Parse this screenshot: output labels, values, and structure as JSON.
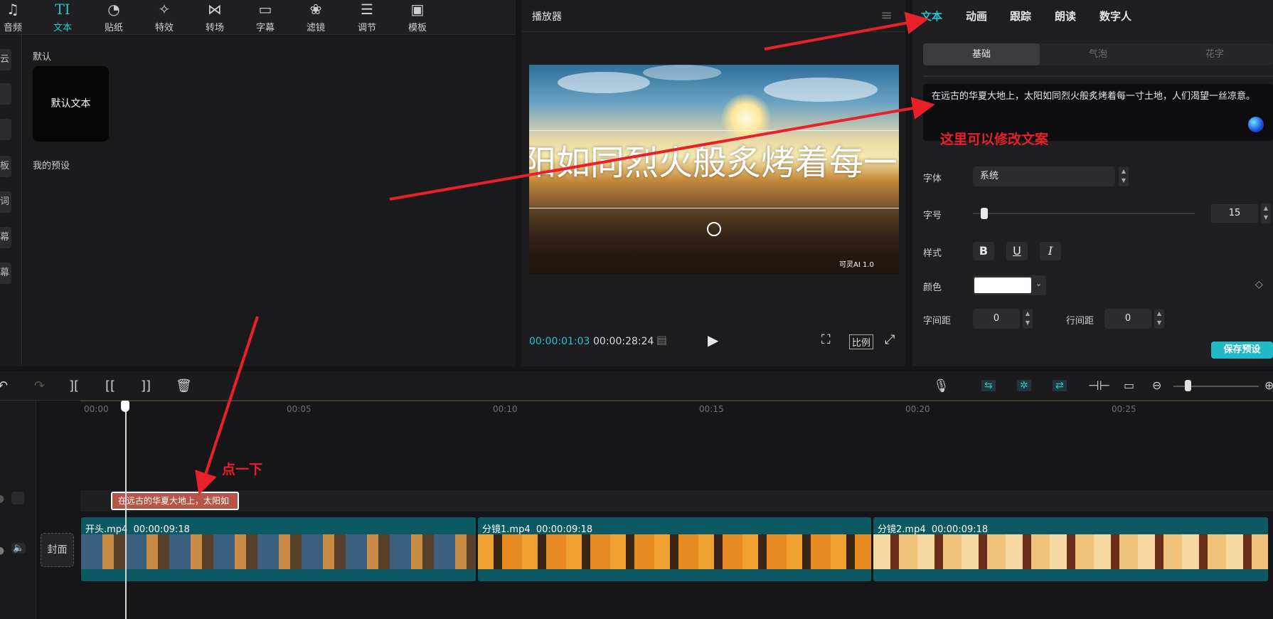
{
  "toolbar": {
    "tools": [
      {
        "label": "音频",
        "icon": "music-note-icon"
      },
      {
        "label": "文本",
        "icon": "text-icon"
      },
      {
        "label": "贴纸",
        "icon": "sticker-icon"
      },
      {
        "label": "特效",
        "icon": "effects-icon"
      },
      {
        "label": "转场",
        "icon": "transition-icon"
      },
      {
        "label": "字幕",
        "icon": "subtitle-icon"
      },
      {
        "label": "滤镜",
        "icon": "filter-icon"
      },
      {
        "label": "调节",
        "icon": "adjust-icon"
      },
      {
        "label": "模板",
        "icon": "template-icon"
      }
    ],
    "active": "文本"
  },
  "left_nav": {
    "items": [
      "云",
      "",
      "",
      "板",
      "词",
      "幕",
      "幕"
    ]
  },
  "library": {
    "default_section": "默认",
    "default_card": "默认文本",
    "preset_section": "我的预设"
  },
  "player": {
    "title": "播放器",
    "overlay_text": "阳如同烈火般炙烤着每一寸土",
    "watermark": "可灵AI 1.0",
    "current_time": "00:00:01:03",
    "total_time": "00:00:28:24",
    "ratio_label": "比例"
  },
  "inspector": {
    "tabs": [
      "文本",
      "动画",
      "跟踪",
      "朗读",
      "数字人"
    ],
    "active_tab": "文本",
    "segments": [
      "基础",
      "气泡",
      "花字"
    ],
    "active_segment": "基础",
    "text_content": "在远古的华夏大地上，太阳如同烈火般炙烤着每一寸土地，人们渴望一丝凉意。",
    "font_label": "字体",
    "font_value": "系统",
    "size_label": "字号",
    "size_value": "15",
    "size_fraction": 0.05,
    "style_label": "样式",
    "style_buttons": [
      "B",
      "U",
      "I"
    ],
    "color_label": "颜色",
    "color_value": "#ffffff",
    "letter_spacing_label": "字间距",
    "letter_spacing_value": "0",
    "line_spacing_label": "行间距",
    "line_spacing_value": "0",
    "save_preset": "保存预设"
  },
  "timeline": {
    "ticks": [
      "00:00",
      "00:05",
      "00:10",
      "00:15",
      "00:20",
      "00:25"
    ],
    "text_clip": "在远古的华夏大地上，太阳如",
    "cover": "封面",
    "clips": [
      {
        "name": "开头.mp4",
        "duration": "00:00:09:18"
      },
      {
        "name": "分镜1.mp4",
        "duration": "00:00:09:18"
      },
      {
        "name": "分镜2.mp4",
        "duration": "00:00:09:18"
      }
    ]
  },
  "annotations": {
    "edit_hint": "这里可以修改文案",
    "click_hint": "点一下",
    "color": "#e8202a"
  }
}
